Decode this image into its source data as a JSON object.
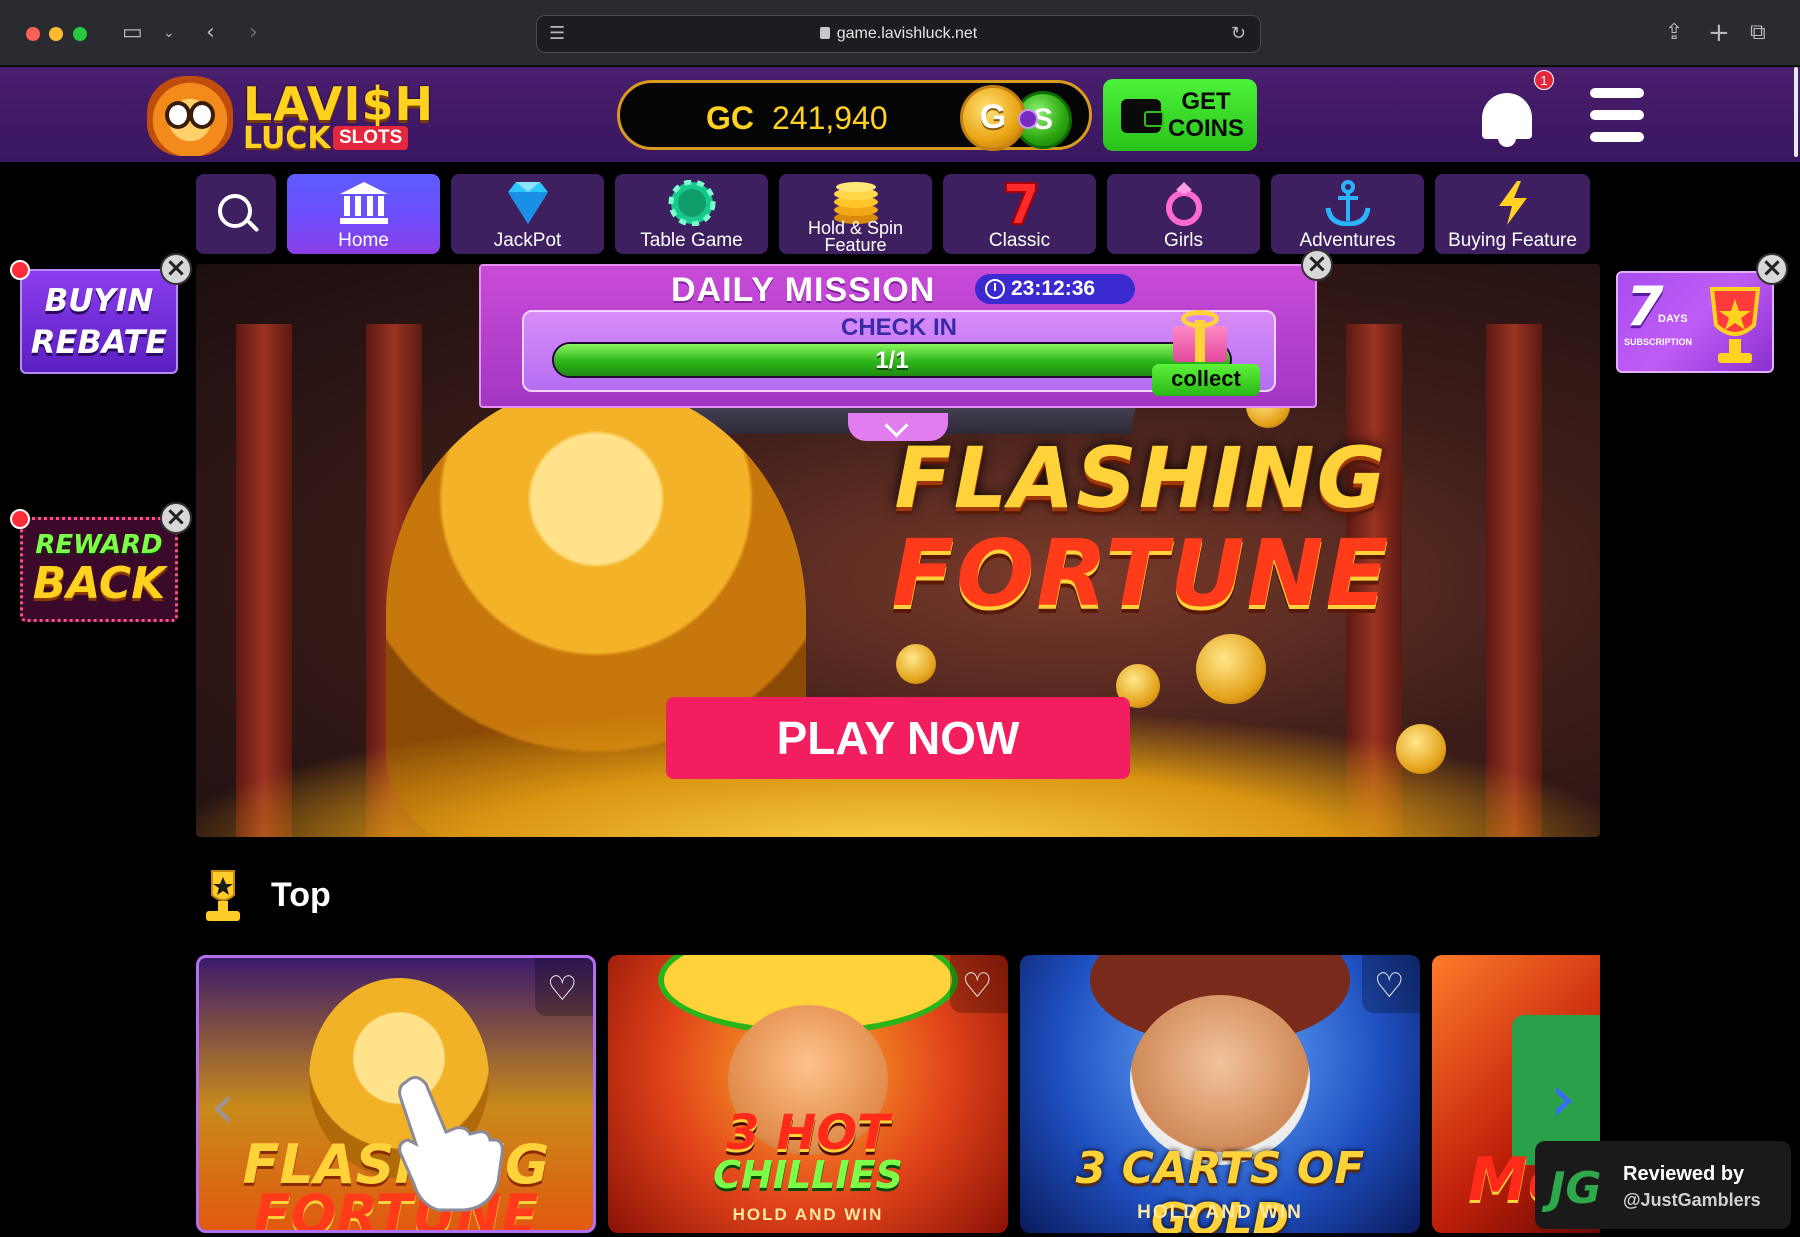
{
  "browser": {
    "url": "game.lavishluck.net"
  },
  "brand": {
    "line1": "LAVI$H",
    "line2": "LUCK",
    "slots": "SLOTS"
  },
  "balance": {
    "currency_label": "GC",
    "value": "241,940",
    "gold_coin_letter": "G",
    "sweep_coin_letter": "S"
  },
  "get_coins": {
    "label_line1": "GET",
    "label_line2": "COINS"
  },
  "notifications": {
    "badge_count": "1"
  },
  "categories": [
    {
      "label": "Home",
      "icon": "bank-icon",
      "active": true
    },
    {
      "label": "JackPot",
      "icon": "diamond-icon"
    },
    {
      "label": "Table Game",
      "icon": "poker-chip-icon"
    },
    {
      "label_line1": "Hold & Spin",
      "label_line2": "Feature",
      "icon": "coin-stack-icon"
    },
    {
      "label": "Classic",
      "icon": "seven-icon"
    },
    {
      "label": "Girls",
      "icon": "ring-icon"
    },
    {
      "label": "Adventures",
      "icon": "anchor-icon"
    },
    {
      "label": "Buying Feature",
      "icon": "lightning-icon"
    }
  ],
  "daily_mission": {
    "title": "DAILY MISSION",
    "timer": "23:12:36",
    "task": "CHECK IN",
    "progress_text": "1/1",
    "progress_fraction": 1.0,
    "collect_label": "collect"
  },
  "banner": {
    "game_line1": "FLASHING",
    "game_line2": "FORTUNE",
    "cta": "PLAY NOW"
  },
  "promos": {
    "rebate_line1": "BUYIN",
    "rebate_line2": "REBATE",
    "reward_line1": "REWARD",
    "reward_line2": "BACK",
    "week_number": "7",
    "week_days": "DAYS",
    "week_sub": "SUBSCRIPTION"
  },
  "top_section": {
    "title": "Top"
  },
  "games": [
    {
      "title_line1": "FLASHING",
      "title_line2": "FORTUNE",
      "subtitle": ""
    },
    {
      "title_line1": "3 HOT",
      "title_line2": "CHILLIES",
      "subtitle": "HOLD AND WIN"
    },
    {
      "title_line1": "3 CARTS OF GOLD",
      "title_line2": "",
      "subtitle": "HOLD AND WIN"
    },
    {
      "title_line1": "Mo",
      "title_line2": "",
      "subtitle": ""
    }
  ],
  "reviewed": {
    "logo": "JG",
    "line1": "Reviewed by",
    "line2": "@JustGamblers"
  },
  "colors": {
    "header_purple": "#4a1e6e",
    "accent_gold": "#ffd21f",
    "cta_pink": "#f21e5f",
    "active_tab_blue": "#5d5cff",
    "get_coins_green": "#4cf23a"
  }
}
